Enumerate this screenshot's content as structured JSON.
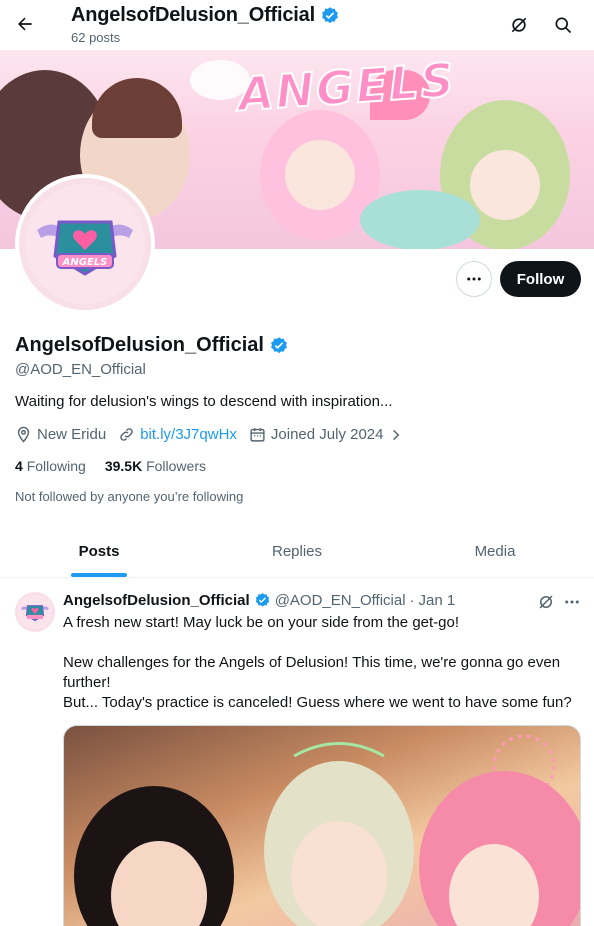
{
  "header": {
    "title": "AngelsofDelusion_Official",
    "post_count": "62 posts"
  },
  "banner": {
    "title_art": "ANGELS"
  },
  "profile": {
    "display_name": "AngelsofDelusion_Official",
    "handle": "@AOD_EN_Official",
    "bio": "Waiting for delusion's wings to descend with inspiration...",
    "location": "New Eridu",
    "link": "bit.ly/3J7qwHx",
    "joined": "Joined July 2024",
    "following_count": "4",
    "following_label": "Following",
    "followers_count": "39.5K",
    "followers_label": "Followers",
    "follow_note": "Not followed by anyone you’re following",
    "follow_button": "Follow",
    "avatar_logo_text": "ANGELS"
  },
  "tabs": [
    {
      "label": "Posts",
      "active": true
    },
    {
      "label": "Replies",
      "active": false
    },
    {
      "label": "Media",
      "active": false
    }
  ],
  "tweet": {
    "author": "AngelsofDelusion_Official",
    "handle": "@AOD_EN_Official",
    "separator": "·",
    "date": "Jan 1",
    "lines": [
      "A fresh new start! May luck be on your side from the get-go!",
      "",
      "New challenges for the Angels of Delusion! This time, we're gonna go even further!",
      "But... Today's practice is canceled! Guess where we went to have some fun?"
    ]
  },
  "colors": {
    "accent": "#1d9bf0",
    "text_primary": "#0f1419",
    "text_secondary": "#536471",
    "follow_bg": "#0f1419",
    "banner_pink": "#fbd3e4"
  },
  "icons": [
    "back-arrow-icon",
    "verified-badge-icon",
    "grok-icon",
    "search-icon",
    "more-icon",
    "location-icon",
    "link-icon",
    "calendar-icon",
    "chevron-right-icon"
  ]
}
